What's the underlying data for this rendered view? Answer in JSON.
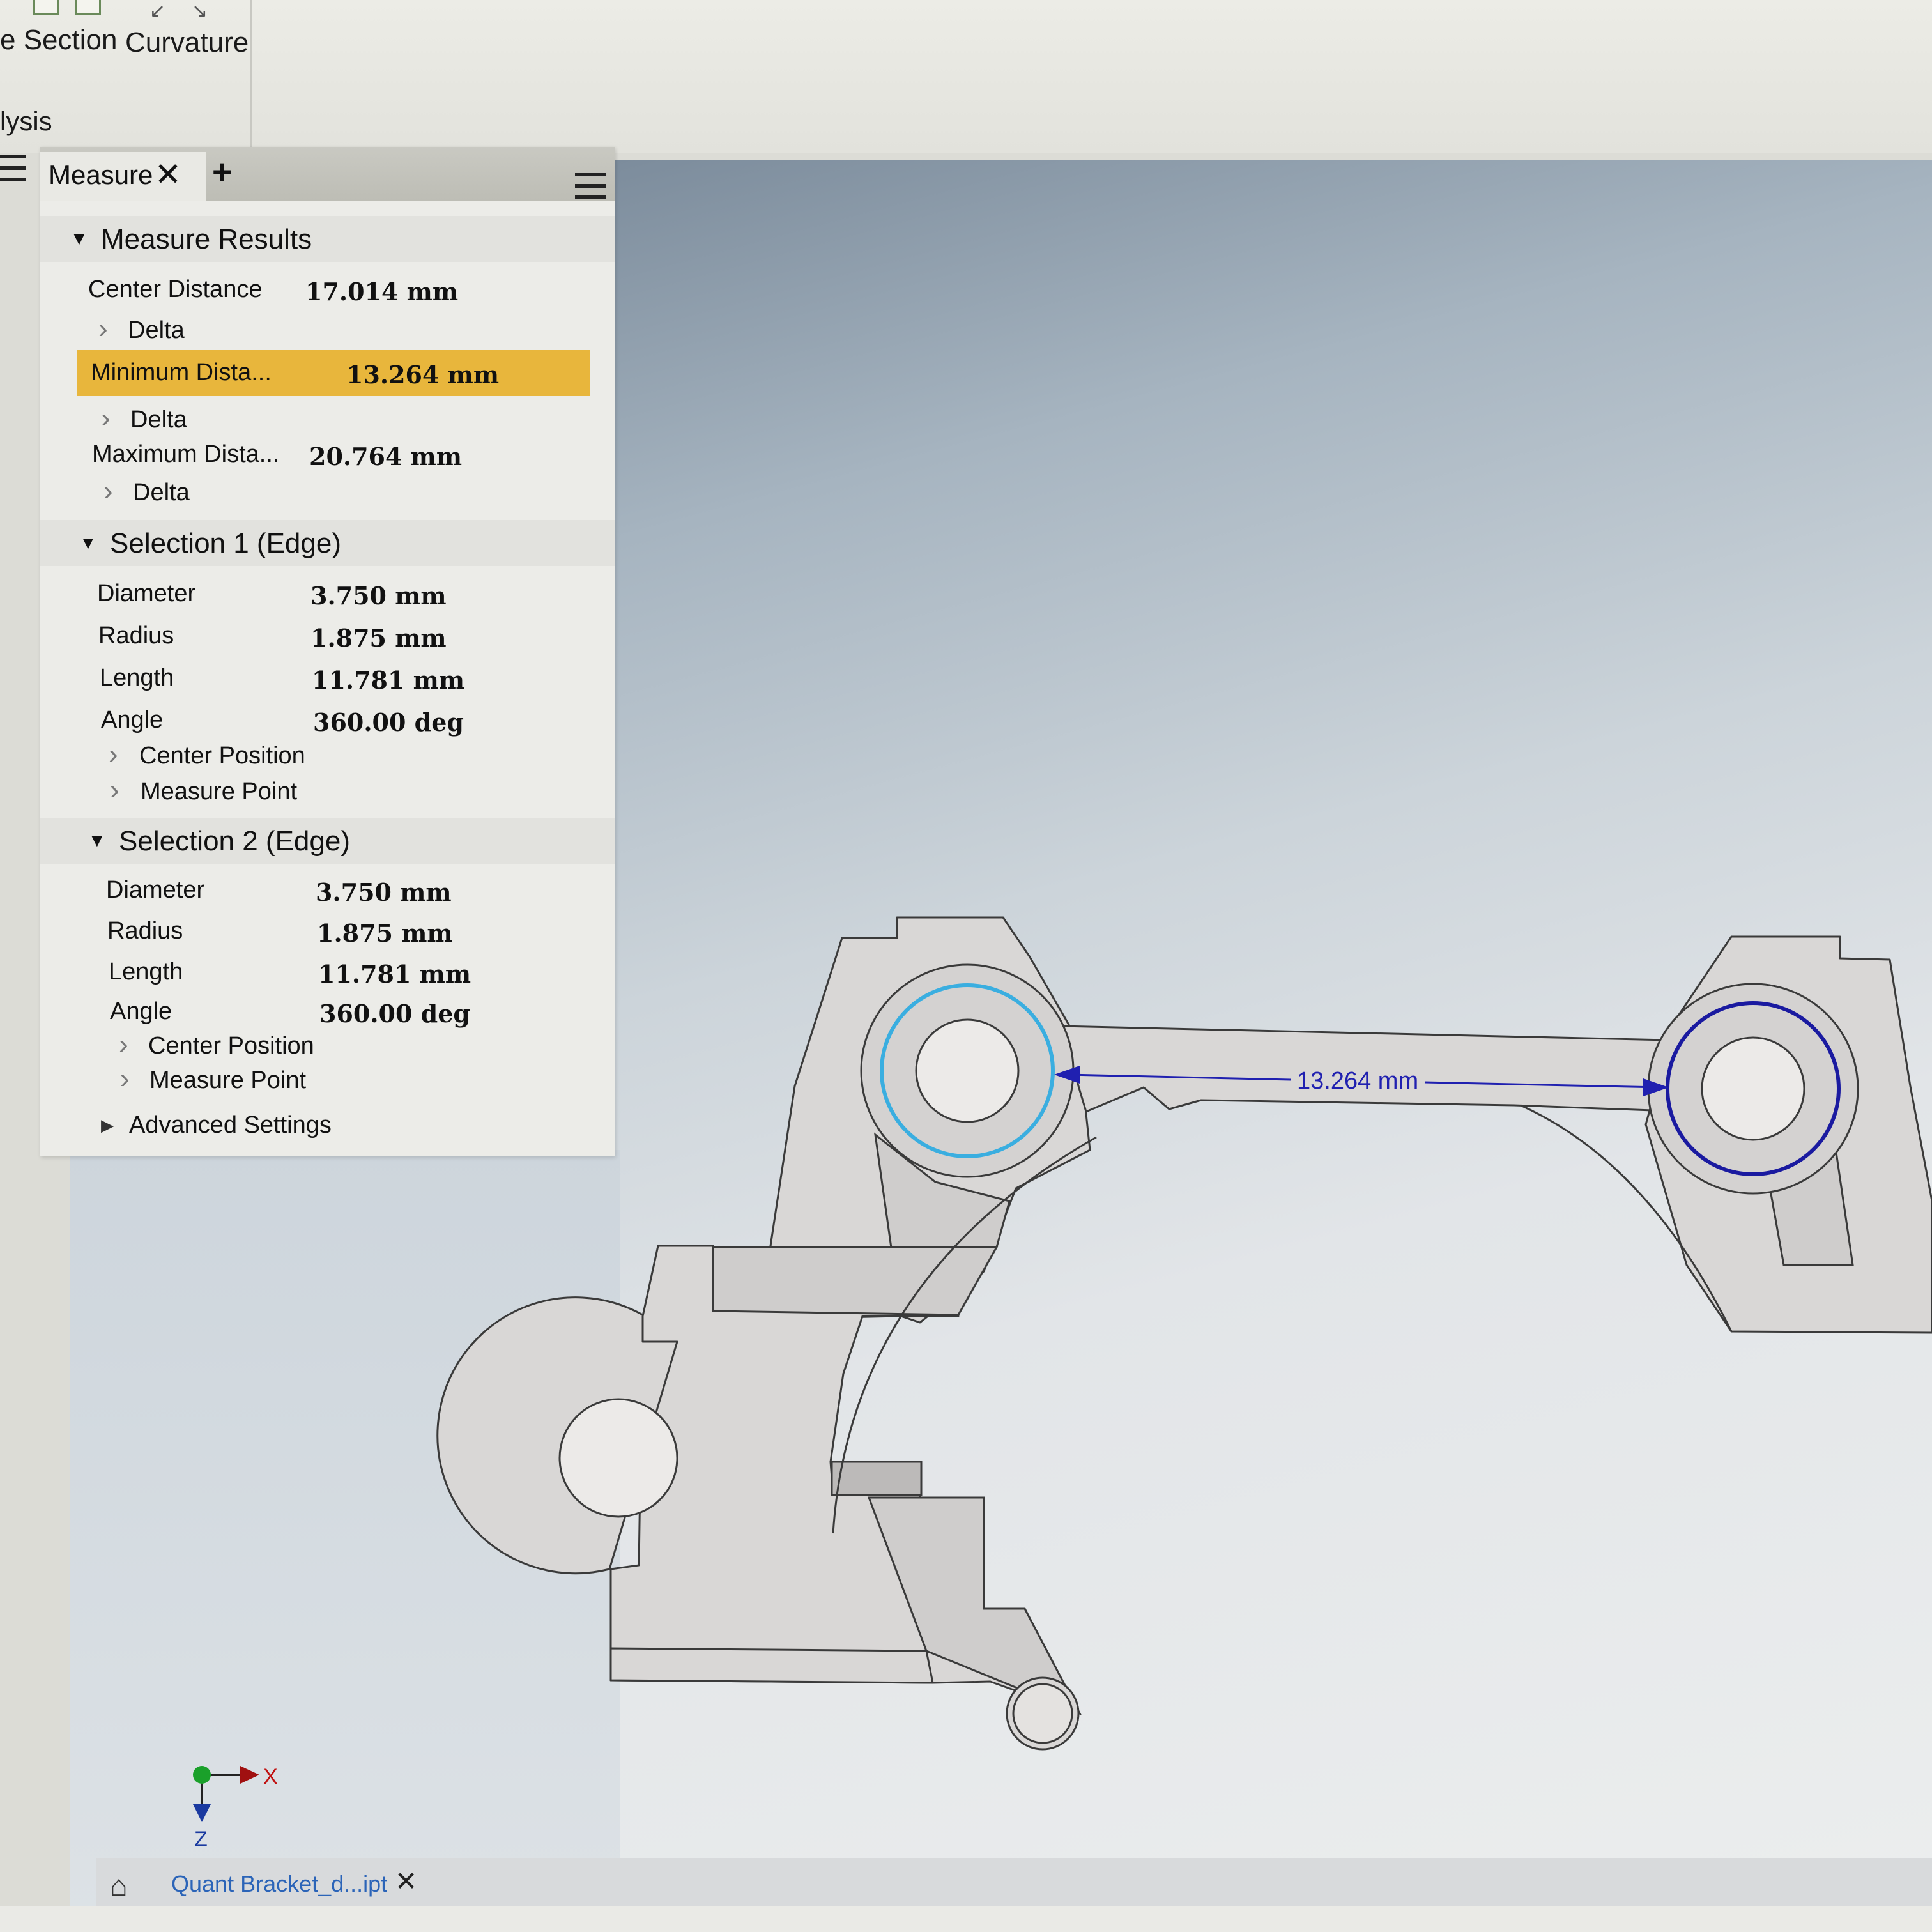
{
  "ribbon": {
    "section_label": "e Section",
    "curvature_label": "Curvature",
    "panel_label": "lysis"
  },
  "panel": {
    "tab_label": "Measure",
    "tab_close": "✕",
    "tab_add": "+",
    "results": {
      "title": "Measure Results",
      "center_distance": {
        "label": "Center Distance",
        "value": "17.014 mm"
      },
      "delta_label": "Delta",
      "minimum_distance": {
        "label": "Minimum Dista...",
        "value": "13.264 mm"
      },
      "maximum_distance": {
        "label": "Maximum Dista...",
        "value": "20.764 mm"
      }
    },
    "selection1": {
      "title": "Selection 1 (Edge)",
      "diameter": {
        "label": "Diameter",
        "value": "3.750 mm"
      },
      "radius": {
        "label": "Radius",
        "value": "1.875 mm"
      },
      "length": {
        "label": "Length",
        "value": "11.781 mm"
      },
      "angle": {
        "label": "Angle",
        "value": "360.00 deg"
      },
      "center_position": "Center Position",
      "measure_point": "Measure Point"
    },
    "selection2": {
      "title": "Selection 2 (Edge)",
      "diameter": {
        "label": "Diameter",
        "value": "3.750 mm"
      },
      "radius": {
        "label": "Radius",
        "value": "1.875 mm"
      },
      "length": {
        "label": "Length",
        "value": "11.781 mm"
      },
      "angle": {
        "label": "Angle",
        "value": "360.00 deg"
      },
      "center_position": "Center Position",
      "measure_point": "Measure Point"
    },
    "advanced_settings": "Advanced Settings"
  },
  "viewport": {
    "dimension_label": "13.264 mm",
    "axis_x": "X",
    "axis_z": "Z"
  },
  "document_tab": {
    "label": "Quant Bracket_d...ipt",
    "close": "✕"
  },
  "colors": {
    "highlight": "#e8b63c",
    "selection1_edge": "#3aaee0",
    "selection2_edge": "#1a1aa0",
    "dimension": "#2020b0",
    "doc_tab_text": "#2b64b8"
  }
}
